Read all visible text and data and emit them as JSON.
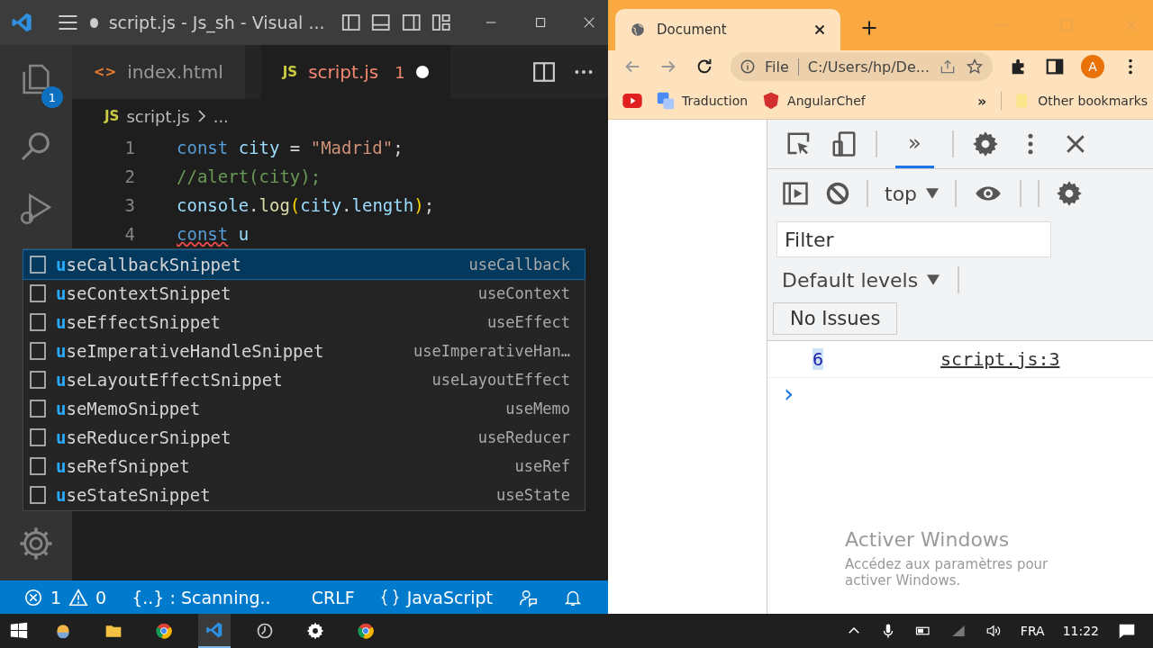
{
  "vscode": {
    "title": "script.js - Js_sh - Visual ...",
    "title_dirty": true,
    "activity": [
      {
        "kind": "explorer",
        "badge": "1"
      },
      {
        "kind": "search"
      },
      {
        "kind": "debug"
      },
      {
        "kind": "settings"
      }
    ],
    "tabs": [
      {
        "icon_text": "<>",
        "kind": "html",
        "label": "index.html",
        "selected": false
      },
      {
        "icon_text": "JS",
        "kind": "js",
        "label": "script.js",
        "problems": "1",
        "dirty": true,
        "selected": true
      }
    ],
    "breadcrumb": {
      "icon_text": "JS",
      "file": "script.js",
      "rest": "..."
    },
    "lines": [
      {
        "number": "1",
        "tokens": [
          {
            "text": "const ",
            "kind": "keyword"
          },
          {
            "text": "city",
            "kind": "variable"
          },
          {
            "text": " = ",
            "kind": "plain"
          },
          {
            "text": "\"Madrid\"",
            "kind": "string"
          },
          {
            "text": ";",
            "kind": "plain"
          }
        ]
      },
      {
        "number": "2",
        "tokens": [
          {
            "text": "//alert(city);",
            "kind": "comment"
          }
        ]
      },
      {
        "number": "3",
        "tokens": [
          {
            "text": "console",
            "kind": "variable"
          },
          {
            "text": ".",
            "kind": "plain"
          },
          {
            "text": "log",
            "kind": "function"
          },
          {
            "text": "(",
            "kind": "paren"
          },
          {
            "text": "city",
            "kind": "variable"
          },
          {
            "text": ".",
            "kind": "plain"
          },
          {
            "text": "length",
            "kind": "variable"
          },
          {
            "text": ")",
            "kind": "paren"
          },
          {
            "text": ";",
            "kind": "plain"
          }
        ]
      },
      {
        "number": "4",
        "tokens": [
          {
            "text": "const",
            "kind": "error"
          },
          {
            "text": " u",
            "kind": "variable"
          }
        ]
      }
    ],
    "suggestions": [
      {
        "label": "**u**seCallbackSnippet",
        "detail": "useCallback",
        "selected": true
      },
      {
        "label": "**u**seContextSnippet",
        "detail": "useContext",
        "selected": false
      },
      {
        "label": "**u**seEffectSnippet",
        "detail": "useEffect",
        "selected": false
      },
      {
        "label": "**u**seImperativeHandleSnippet",
        "detail": "useImperativeHan…",
        "selected": false
      },
      {
        "label": "**u**seLayoutEffectSnippet",
        "detail": "useLayoutEffect",
        "selected": false
      },
      {
        "label": "**u**seMemoSnippet",
        "detail": "useMemo",
        "selected": false
      },
      {
        "label": "**u**seReducerSnippet",
        "detail": "useReducer",
        "selected": false
      },
      {
        "label": "**u**seRefSnippet",
        "detail": "useRef",
        "selected": false
      },
      {
        "label": "**u**seStateSnippet",
        "detail": "useState",
        "selected": false
      }
    ],
    "status": {
      "errors": "1",
      "warnings": "0",
      "scanning": "{..} : Scanning..",
      "eol": "CRLF",
      "language": "JavaScript"
    }
  },
  "chrome": {
    "tab": "Document",
    "scheme": "File",
    "url": "C:/Users/hp/De...",
    "avatar": "A",
    "bookmarks": [
      {
        "kind": "youtube"
      },
      {
        "kind": "translate",
        "label": "Traduction"
      },
      {
        "kind": "angular",
        "label": "AngularChef"
      }
    ],
    "more": "»",
    "other": "Other bookmarks",
    "devtools": {
      "tabs": [
        {
          "label": "»",
          "selected": true
        }
      ],
      "context": "top",
      "filter_placeholder": "Filter",
      "levels": "Default levels",
      "issues": "No Issues",
      "log": [
        {
          "value": "6",
          "source": "script.js:3"
        }
      ],
      "prompt": "›"
    },
    "activation": {
      "title": "Activer Windows",
      "text": "Accédez aux paramètres pour activer Windows."
    }
  },
  "taskbar": {
    "apps": [
      {
        "kind": "weather",
        "selected": false
      },
      {
        "kind": "folder",
        "selected": false
      },
      {
        "kind": "chrome",
        "selected": false
      },
      {
        "kind": "vscode",
        "selected": true
      },
      {
        "kind": "clock",
        "selected": false
      },
      {
        "kind": "gear",
        "selected": false
      },
      {
        "kind": "chrome",
        "selected": false
      }
    ],
    "language": "FRA",
    "time": "11:22"
  }
}
